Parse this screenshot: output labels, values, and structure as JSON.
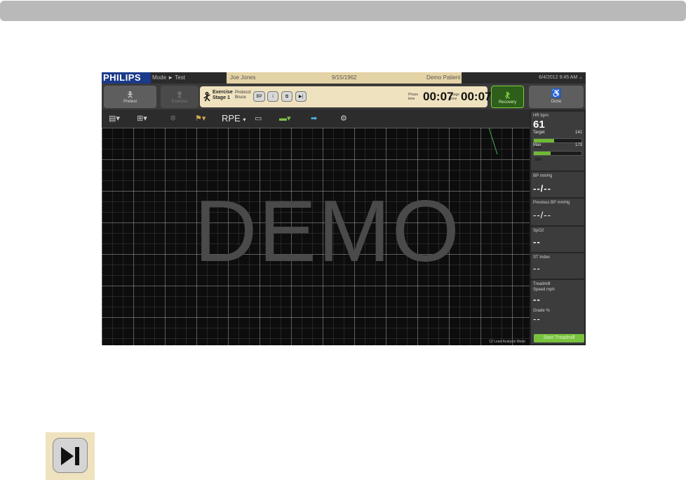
{
  "header": {
    "logo_text": "PHILIPS",
    "mode_label": "Mode",
    "mode_value": "Test",
    "patient_name": "Joe Jones",
    "patient_id": "9/15/1962",
    "patient_status": "Demo Patient",
    "date_time": "6/4/2012 9:45 AM"
  },
  "phases": {
    "pretest_label": "Pretest",
    "exercise_label": "Exercise",
    "recovery_label": "Recovery",
    "done_label": "Done"
  },
  "stage": {
    "title": "Exercise Stage 1",
    "subtitle": "Protocol: Bruce",
    "bp_label": "BP",
    "phase_time_label": "Phase time",
    "phase_time": "00:07",
    "stage_time_label": "Stage time",
    "stage_time": "00:07"
  },
  "toolbar": {
    "rpe_label": "RPE"
  },
  "watermark": "DEMO",
  "footnote": "12 Lead Analysis Mode",
  "right_panel": {
    "hr_label": "HR bpm",
    "hr_value": "61",
    "target_label": "Target",
    "target_value": "141",
    "target_bar_label": "43%",
    "target_fraction": 0.43,
    "max_label": "Max",
    "max_value": "173",
    "max_bar_label": "35%",
    "max_fraction": 0.35,
    "bp_label": "BP mmHg",
    "bp_value": "--/--",
    "prev_bp_label": "Previous BP mmHg",
    "prev_bp_value": "--/--",
    "spo2_label": "SpO2",
    "spo2_value": "--",
    "st_label": "ST Index",
    "st_value": "--",
    "treadmill_label": "Treadmill",
    "speed_label": "Speed mph",
    "speed_value": "--",
    "grade_label": "Grade %",
    "grade_value": "--",
    "start_button": "Start Treadmill"
  }
}
